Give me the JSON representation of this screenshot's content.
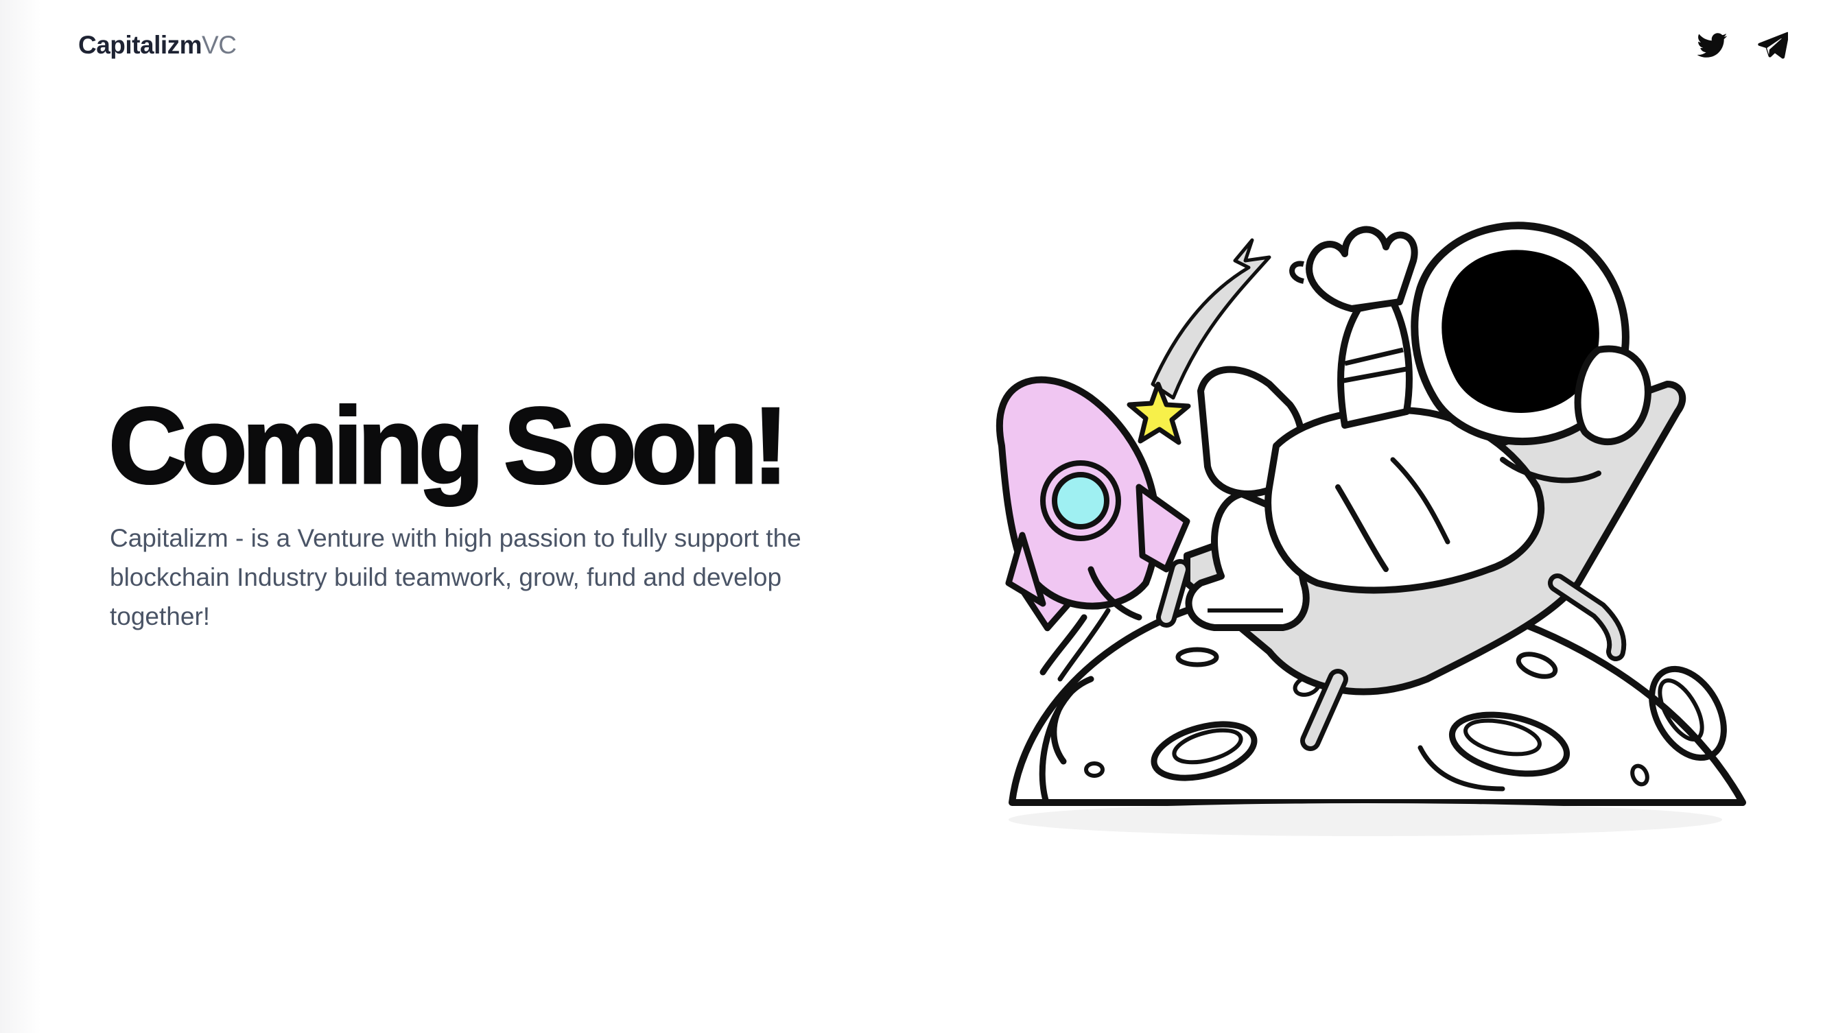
{
  "header": {
    "logo_strong": "Capitalizm",
    "logo_light": "VC",
    "socials": [
      {
        "name": "twitter",
        "icon": "twitter-icon"
      },
      {
        "name": "telegram",
        "icon": "telegram-icon"
      }
    ]
  },
  "hero": {
    "headline": "Coming Soon!",
    "description": "Capitalizm - is a Venture with high passion to fully support the blockchain Industry build teamwork, grow, fund and develop together!"
  },
  "illustration": {
    "subject": "astronaut-on-moon",
    "colors": {
      "rocket": "#f0c6f2",
      "porthole": "#9ff0f2",
      "star": "#f7f04a",
      "chair": "#dedede",
      "visor": "#000000",
      "outline": "#111111"
    }
  },
  "theme": {
    "text_dark": "#0b0b0c",
    "text_muted": "#4a5466",
    "logo_dark": "#1e2333",
    "logo_light": "#737a88",
    "background": "#ffffff"
  }
}
